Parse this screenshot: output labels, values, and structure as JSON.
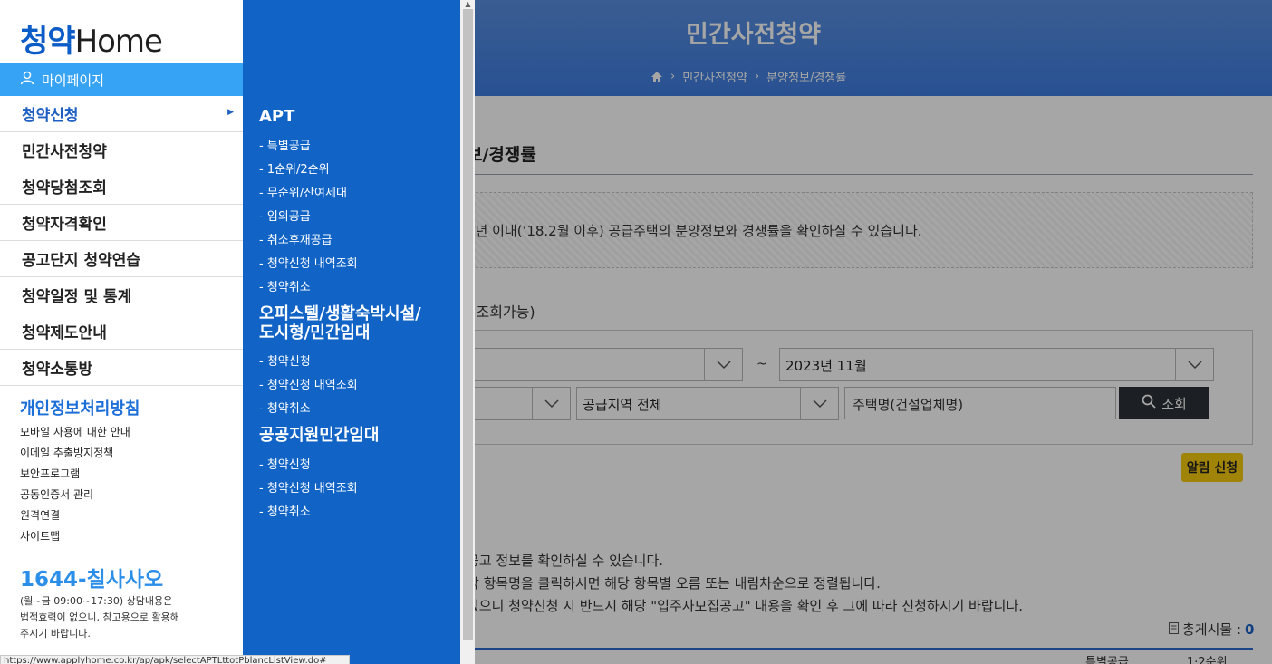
{
  "background": {
    "hero_title": "민간사전청약",
    "breadcrumb": [
      "민간사전청약",
      "분양정보/경쟁률"
    ],
    "section_title_fragment": "보/경쟁률",
    "notice_text_fragment": "5년 이내(’18.2월 이후) 공급주택의 분양정보와 경쟁률을 확인하실 수 있습니다.",
    "query_note_fragment": "| 조회가능)",
    "from_month": "",
    "to_tilde": "~",
    "to_month": "2023년 11월",
    "region_select": "공급지역 전체",
    "search_placeholder": "주택명(건설업체명)",
    "search_button": "조회",
    "alert_button": "알림 신청",
    "info_lines": [
      "공고 정보를 확인하실 수 있습니다.",
      "각 항목명을 클릭하시면 해당 항목별 오름 또는 내림차순으로 정렬됩니다.",
      "있으니 청약신청 시 반드시 해당 \"입주자모집공고\" 내용을 확인 후 그에 따라 신청하시기 바랍니다."
    ],
    "total_label": "총게시물 :",
    "total_count": "0",
    "table_heads": [
      "특별공급",
      "1·2순위"
    ]
  },
  "left_menu": {
    "logo_prefix": "청약",
    "logo_suffix": "Home",
    "mypage_label": "마이페이지",
    "items": [
      {
        "label": "청약신청",
        "active": true
      },
      {
        "label": "민간사전청약"
      },
      {
        "label": "청약당첨조회"
      },
      {
        "label": "청약자격확인"
      },
      {
        "label": "공고단지 청약연습"
      },
      {
        "label": "청약일정 및 통계"
      },
      {
        "label": "청약제도안내"
      },
      {
        "label": "청약소통방"
      }
    ],
    "policy_label": "개인정보처리방침",
    "links": [
      "모바일 사용에 대한 안내",
      "이메일 추출방지정책",
      "보안프로그램",
      "공동인증서 관리",
      "원격연결",
      "사이트맵"
    ],
    "phone": "1644-칠사사오",
    "hours_line1": "(월~금 09:00~17:30) 상담내용은",
    "hours_line2": "법적효력이 없으니, 참고용으로 활용해",
    "hours_line3": "주시기 바랍니다."
  },
  "sub_menu": {
    "groups": [
      {
        "heading": "APT",
        "items": [
          "- 특별공급",
          "- 1순위/2순위",
          "- 무순위/잔여세대",
          "- 임의공급",
          "- 취소후재공급",
          "- 청약신청 내역조회",
          "- 청약취소"
        ]
      },
      {
        "heading_line1": "오피스텔/생활숙박시설/",
        "heading_line2": "도시형/민간임대",
        "items": [
          "- 청약신청",
          "- 청약신청 내역조회",
          "- 청약취소"
        ]
      },
      {
        "heading": "공공지원민간임대",
        "items": [
          "- 청약신청",
          "- 청약신청 내역조회",
          "- 청약취소"
        ]
      }
    ]
  },
  "status_url": "https://www.applyhome.co.kr/ap/apk/selectAPTLttotPblancListView.do#",
  "colors": {
    "brand_blue": "#1164c6",
    "mypage_bar": "#36a3f4",
    "accent_yellow": "#f6c90f"
  }
}
